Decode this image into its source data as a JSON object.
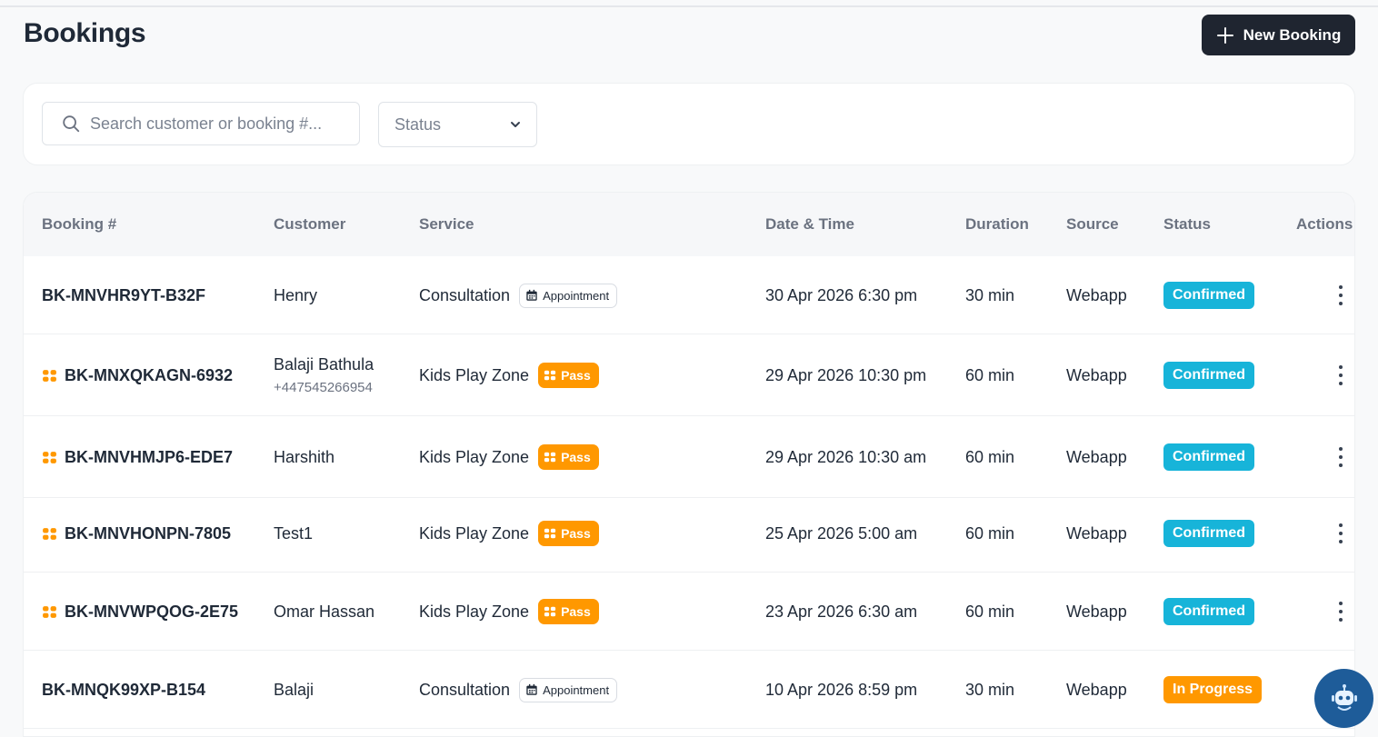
{
  "header": {
    "title": "Bookings",
    "new_booking_label": "New Booking"
  },
  "filters": {
    "search_placeholder": "Search customer or booking #...",
    "status_placeholder": "Status"
  },
  "table": {
    "columns": [
      "Booking #",
      "Customer",
      "Service",
      "Date & Time",
      "Duration",
      "Source",
      "Status",
      "Actions"
    ],
    "rows": [
      {
        "booking": "BK-MNVHR9YT-B32F",
        "pass": false,
        "customer": "Henry",
        "phone": "",
        "service": "Consultation",
        "badge": "Appointment",
        "badge_type": "appointment",
        "datetime": "30 Apr 2026 6:30 pm",
        "duration": "30 min",
        "source": "Webapp",
        "status": "Confirmed",
        "status_color": "#17b4d9"
      },
      {
        "booking": "BK-MNXQKAGN-6932",
        "pass": true,
        "customer": "Balaji Bathula",
        "phone": "+447545266954",
        "service": "Kids Play Zone",
        "badge": "Pass",
        "badge_type": "pass",
        "datetime": "29 Apr 2026 10:30 pm",
        "duration": "60 min",
        "source": "Webapp",
        "status": "Confirmed",
        "status_color": "#17b4d9"
      },
      {
        "booking": "BK-MNVHMJP6-EDE7",
        "pass": true,
        "customer": "Harshith",
        "phone": "",
        "service": "Kids Play Zone",
        "badge": "Pass",
        "badge_type": "pass",
        "datetime": "29 Apr 2026 10:30 am",
        "duration": "60 min",
        "source": "Webapp",
        "status": "Confirmed",
        "status_color": "#17b4d9"
      },
      {
        "booking": "BK-MNVHONPN-7805",
        "pass": true,
        "customer": "Test1",
        "phone": "",
        "service": "Kids Play Zone",
        "badge": "Pass",
        "badge_type": "pass",
        "datetime": "25 Apr 2026 5:00 am",
        "duration": "60 min",
        "source": "Webapp",
        "status": "Confirmed",
        "status_color": "#17b4d9"
      },
      {
        "booking": "BK-MNVWPQOG-2E75",
        "pass": true,
        "customer": "Omar Hassan",
        "phone": "",
        "service": "Kids Play Zone",
        "badge": "Pass",
        "badge_type": "pass",
        "datetime": "23 Apr 2026 6:30 am",
        "duration": "60 min",
        "source": "Webapp",
        "status": "Confirmed",
        "status_color": "#17b4d9"
      },
      {
        "booking": "BK-MNQK99XP-B154",
        "pass": false,
        "customer": "Balaji",
        "phone": "",
        "service": "Consultation",
        "badge": "Appointment",
        "badge_type": "appointment",
        "datetime": "10 Apr 2026 8:59 pm",
        "duration": "30 min",
        "source": "Webapp",
        "status": "In Progress",
        "status_color": "#ff9800"
      }
    ]
  },
  "icons": {
    "search": "search-icon",
    "chevron": "chevron-down-icon",
    "pass": "pass-icon",
    "calendar": "calendar-icon",
    "more": "more-vertical-icon",
    "assistant": "robot-icon"
  },
  "colors": {
    "primary_button": "#1f2530",
    "confirmed": "#17b4d9",
    "in_progress": "#ff9800",
    "pass_badge": "#ff9800",
    "assistant_button": "#1e5c99"
  }
}
